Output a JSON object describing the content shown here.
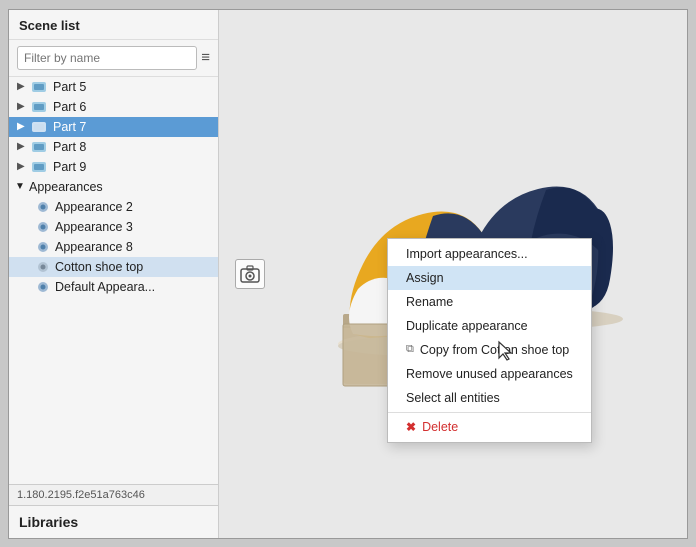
{
  "window": {
    "title": "Scene list"
  },
  "sidebar": {
    "title": "Scene list",
    "filter_placeholder": "Filter by name",
    "parts": [
      {
        "id": "part5",
        "label": "Part 5",
        "expanded": false
      },
      {
        "id": "part6",
        "label": "Part 6",
        "expanded": false
      },
      {
        "id": "part7",
        "label": "Part 7",
        "expanded": false,
        "selected": true
      },
      {
        "id": "part8",
        "label": "Part 8",
        "expanded": false
      },
      {
        "id": "part9",
        "label": "Part 9",
        "expanded": false
      }
    ],
    "appearances_section": {
      "label": "Appearances",
      "expanded": true,
      "items": [
        {
          "id": "app2",
          "label": "Appearance 2"
        },
        {
          "id": "app3",
          "label": "Appearance 3"
        },
        {
          "id": "app8",
          "label": "Appearance 8"
        },
        {
          "id": "cotton",
          "label": "Cotton shoe top",
          "context_target": true
        },
        {
          "id": "default",
          "label": "Default Appeara..."
        }
      ]
    },
    "status_text": "1.180.2195.f2e51a763c46",
    "libraries_label": "Libraries"
  },
  "context_menu": {
    "items": [
      {
        "id": "import",
        "label": "Import appearances...",
        "active": false
      },
      {
        "id": "assign",
        "label": "Assign",
        "active": true
      },
      {
        "id": "rename",
        "label": "Rename",
        "active": false
      },
      {
        "id": "duplicate",
        "label": "Duplicate appearance",
        "active": false
      },
      {
        "id": "copy",
        "label": "Copy from Cotton shoe top",
        "active": false
      },
      {
        "id": "remove",
        "label": "Remove unused appearances",
        "active": false
      },
      {
        "id": "select_all",
        "label": "Select all entities",
        "active": false
      },
      {
        "id": "delete",
        "label": "Delete",
        "active": false,
        "danger": true
      }
    ]
  },
  "icons": {
    "arrow_right": "▶",
    "arrow_down": "▼",
    "part_icon": "⬡",
    "appearance_icon": "◈",
    "list_view": "≡",
    "camera": "📷",
    "cursor": "👆",
    "delete_x": "✖",
    "copy_icon": "⧉"
  }
}
